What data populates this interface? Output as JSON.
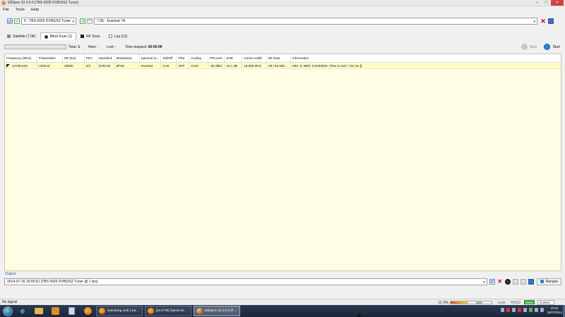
{
  "window": {
    "title": "EBSpro 10.4.0.0 [TBS 6925 DVBS/S2 Tuner]",
    "buttons": [
      "minimize",
      "maximize",
      "close"
    ]
  },
  "menu": [
    "File",
    "Tools",
    "Help"
  ],
  "toolbar": {
    "tuner": "0 - TBS 6925 DVBS/S2 Tuner",
    "satellite": "7.0E - Eutelsat 7A"
  },
  "tabs": [
    {
      "label": "Satellite (7.0E)",
      "icon": "satellite-icon",
      "active": false
    },
    {
      "label": "Blind Scan (1)",
      "icon": "blind-scan-icon",
      "active": true
    },
    {
      "label": "RF Scan",
      "icon": "rf-scan-icon",
      "active": false
    },
    {
      "label": "Log (13)",
      "icon": "log-icon",
      "active": false
    }
  ],
  "scan": {
    "progress": 0.0,
    "total_label": "Total:",
    "total_value": "1",
    "new_label": "New:",
    "new_value": "-",
    "lost_label": "Lost:",
    "lost_value": "-",
    "elapsed_label": "Time elapsed:",
    "elapsed_value": "00:00:06",
    "stop_label": "Stop",
    "start_label": "Start"
  },
  "table": {
    "columns": [
      "Frequency (MHz)",
      "Polarization",
      "SR (KS)",
      "FEC",
      "Standard",
      "Modulation",
      "Spectral m...",
      "RollOff",
      "Pilot",
      "Coding ...",
      "RFLevel",
      "SNR",
      "Carrier width",
      "Bit Rate",
      "Information"
    ],
    "rows": [
      [
        "12736,518",
        "Vertical",
        "15000",
        "2/3",
        "DVB-S2",
        "8PSK",
        "Inverted",
        "0.20",
        "OFF",
        "CCM",
        "-53 dBm",
        "10,1 dB",
        "18,000 MHz",
        "29,715 Mbi...",
        "MIS: 0, BER: 0,0000000, Time to lock: 716 ms ]]"
      ]
    ]
  },
  "output": {
    "label": "Output",
    "value": "2014-07-16 20:00:51 [TBS 6925 DVBS/S2 Tuner @ 1 tps]",
    "ranges_label": "Ranges"
  },
  "statusbar": {
    "left": "No signal",
    "quality": "Q: 0%",
    "level_fraction": 0.43,
    "level_text": "43%",
    "lock": "Lock",
    "hold": "HOLD",
    "mode": "Green",
    "control": "Control"
  },
  "taskbar": {
    "tasks": [
      {
        "label": "Samsung Link | Sa...",
        "icon": "firefox-icon"
      },
      {
        "label": "[24.5°W] Opera W...",
        "icon": "firefox-icon"
      },
      {
        "label": "EBSpro 10.4.0.0 [T...",
        "icon": "ebspro-icon"
      }
    ],
    "time": "20:01",
    "date": "16/07/2014"
  }
}
